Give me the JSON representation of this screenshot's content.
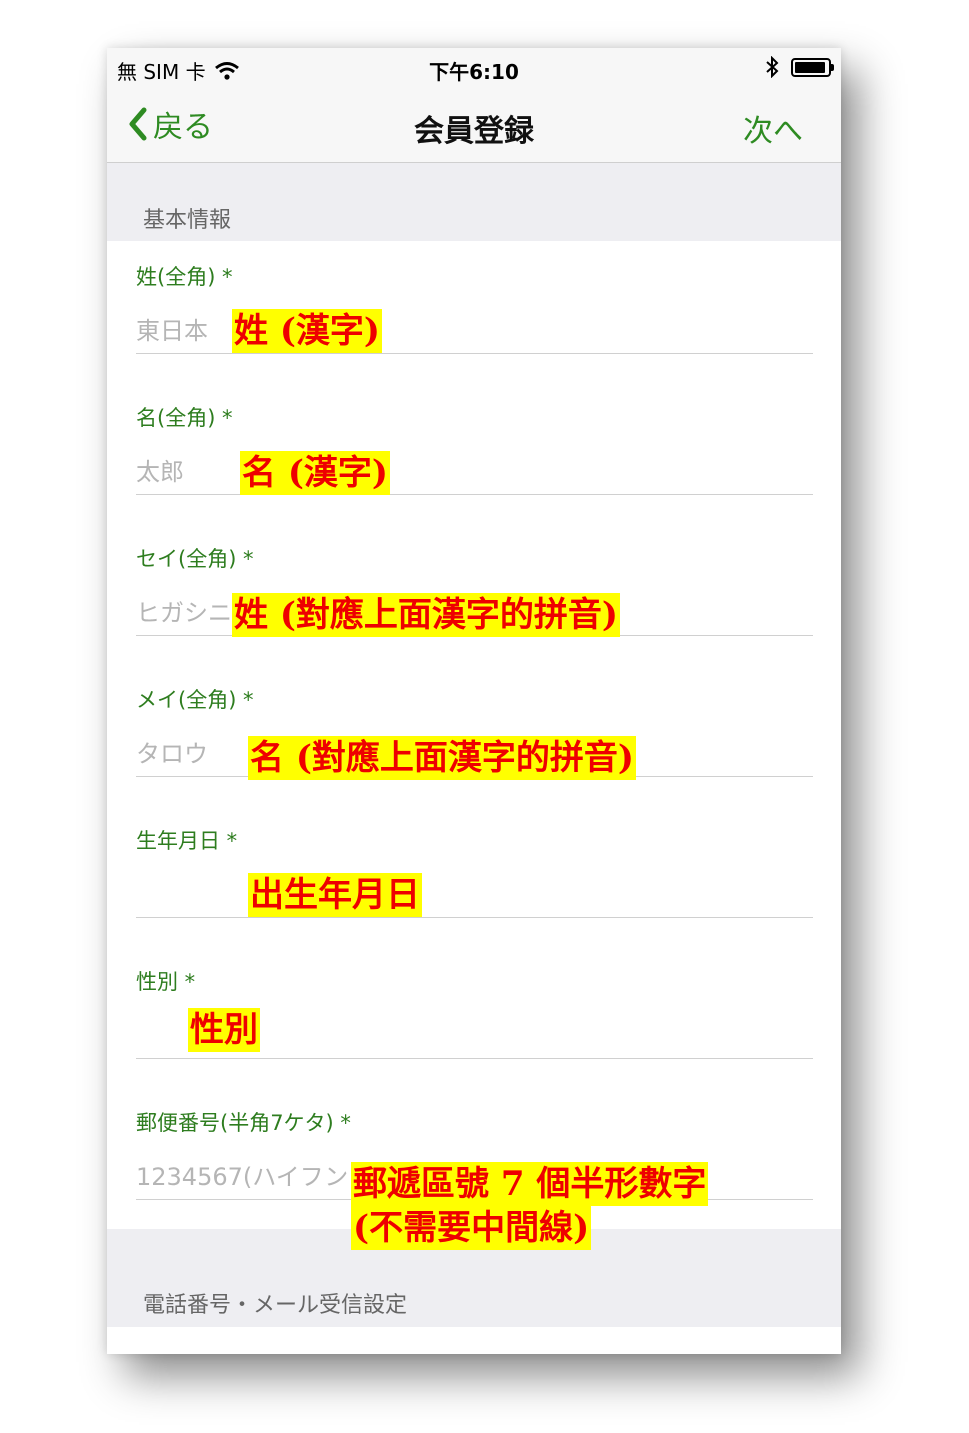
{
  "status_bar": {
    "carrier": "無 SIM 卡",
    "time": "下午6:10"
  },
  "nav": {
    "back_label": "戻る",
    "title": "会員登録",
    "next_label": "次へ"
  },
  "sections": {
    "basic": "基本情報",
    "contact": "電話番号・メール受信設定"
  },
  "fields": [
    {
      "label": "姓(全角) *",
      "placeholder": "東日本"
    },
    {
      "label": "名(全角) *",
      "placeholder": "太郎"
    },
    {
      "label": "セイ(全角) *",
      "placeholder": "ヒガシニ"
    },
    {
      "label": "メイ(全角) *",
      "placeholder": "タロウ"
    },
    {
      "label": "生年月日 *",
      "placeholder": ""
    },
    {
      "label": "性別 *",
      "placeholder": ""
    },
    {
      "label": "郵便番号(半角7ケタ) *",
      "placeholder": "1234567(ハイフン"
    }
  ],
  "annotations": [
    "姓 (漢字)",
    "名 (漢字)",
    "姓 (對應上面漢字的拼音)",
    "名 (對應上面漢字的拼音)",
    "出生年月日",
    "性別",
    "郵遞區號 7 個半形數字",
    "(不需要中間線)"
  ],
  "colors": {
    "accent": "#2e7d1f",
    "highlight": "#ffff00",
    "annotation_text": "#ee0000"
  }
}
